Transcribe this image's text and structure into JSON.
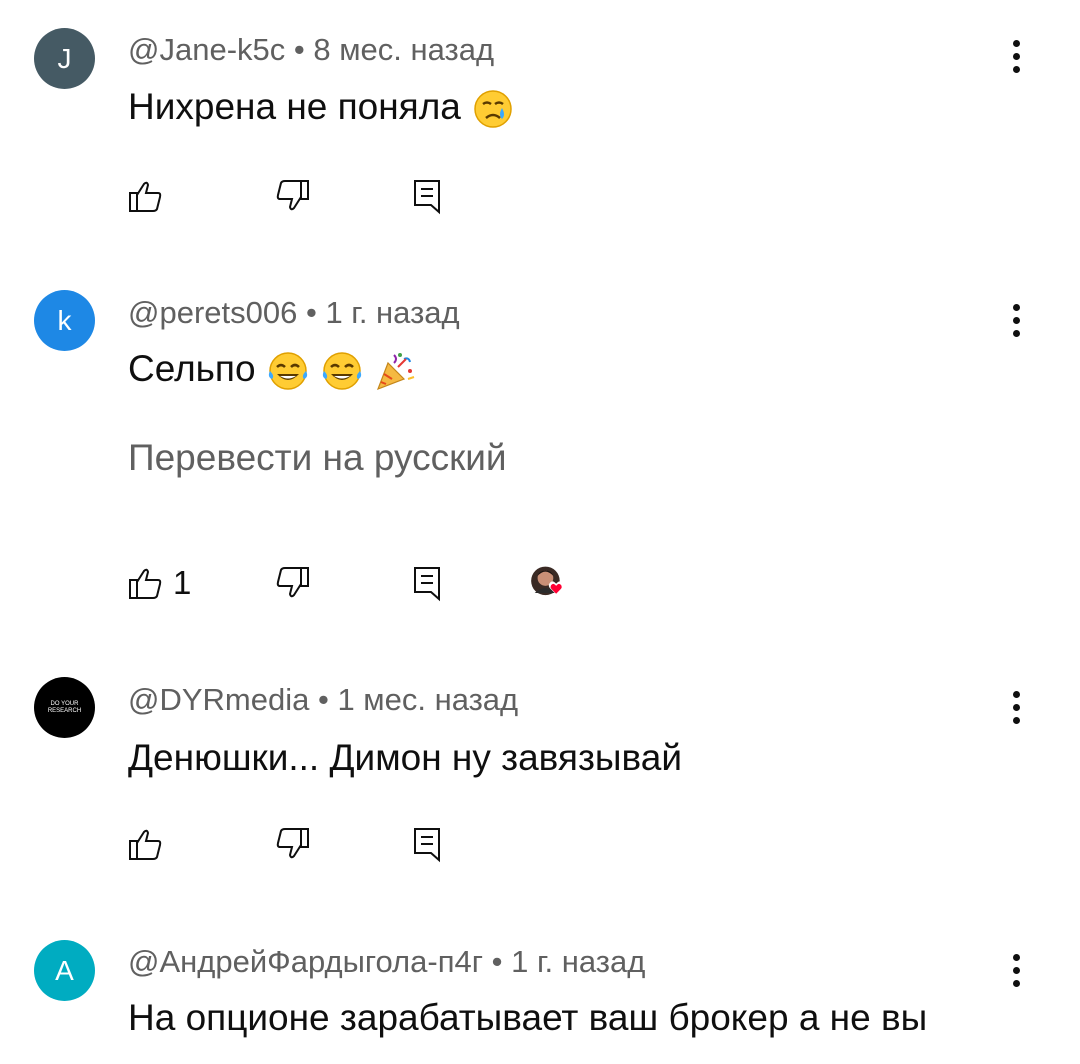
{
  "comments": [
    {
      "avatar_letter": "J",
      "avatar_color": "#455a64",
      "author": "@Jane-k5c",
      "time": "8 мес. назад",
      "text": "Нихрена не поняла",
      "emoji": [
        "crying-face"
      ],
      "likes": "",
      "translate": ""
    },
    {
      "avatar_letter": "k",
      "avatar_color": "#1e88e5",
      "author": "@perets006",
      "time": "1 г. назад",
      "text": "Сельпо ",
      "emoji": [
        "tears-of-joy",
        "tears-of-joy",
        "party-popper"
      ],
      "likes": "1",
      "translate": "Перевести на русский"
    },
    {
      "avatar_letter": "",
      "avatar_label": "DO YOUR RESEARCH",
      "avatar_color": "#000000",
      "author": "@DYRmedia",
      "time": "1 мес. назад",
      "text": "Денюшки... Димон ну завязывай",
      "emoji": [],
      "likes": "",
      "translate": ""
    },
    {
      "avatar_letter": "A",
      "avatar_color": "#00acc1",
      "author": "@АндрейФардыгола-п4г",
      "time": "1 г. назад",
      "text": "На опционе зарабатывает ваш брокер а не вы",
      "emoji": [],
      "likes": "",
      "translate": ""
    }
  ],
  "separator": " • ",
  "icons": {
    "like": "thumb-up-icon",
    "dislike": "thumb-down-icon",
    "reply": "reply-icon",
    "menu": "more-vert-icon",
    "heart": "creator-heart-icon"
  },
  "colors": {
    "meta_text": "#606060",
    "main_text": "#0f0f0f",
    "heart": "#ff0033"
  }
}
